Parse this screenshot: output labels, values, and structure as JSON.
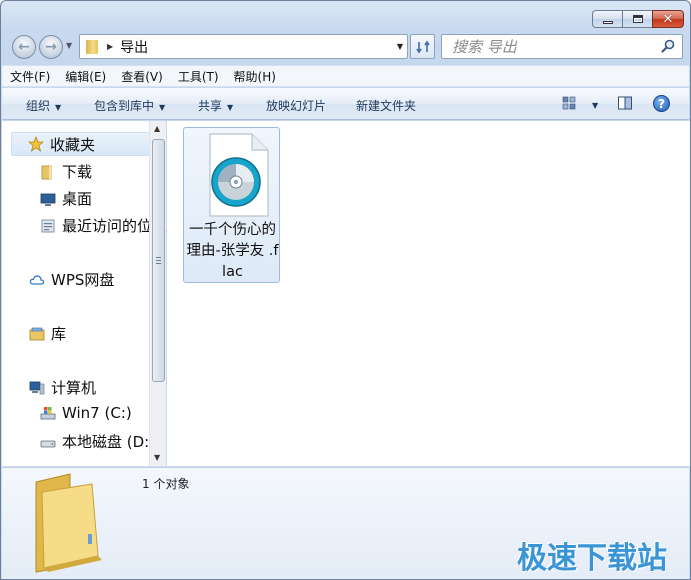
{
  "window": {
    "caption_buttons": {
      "minimize": "minimize",
      "maximize": "maximize",
      "close": "✕"
    }
  },
  "address": {
    "path": "导出"
  },
  "search": {
    "placeholder": "搜索 导出"
  },
  "menu": [
    "文件(F)",
    "编辑(E)",
    "查看(V)",
    "工具(T)",
    "帮助(H)"
  ],
  "commands": {
    "organize": "组织",
    "include_in_library": "包含到库中",
    "share": "共享",
    "slideshow": "放映幻灯片",
    "new_folder": "新建文件夹"
  },
  "nav_tree": {
    "favorites": "收藏夹",
    "downloads": "下载",
    "desktop": "桌面",
    "recent": "最近访问的位置",
    "wps": "WPS网盘",
    "library": "库",
    "computer": "计算机",
    "drive_c": "Win7 (C:)",
    "drive_d": "本地磁盘 (D:)"
  },
  "files": [
    {
      "name": "一千个伤心的理由-张学友 .flac",
      "type": "flac-audio-icon"
    }
  ],
  "details": {
    "status": "1 个对象"
  },
  "watermark": "极速下载站",
  "colors": {
    "accent": "#3a95d6",
    "selection": "#d8e7f8",
    "toolbar_text": "#1e395b"
  }
}
